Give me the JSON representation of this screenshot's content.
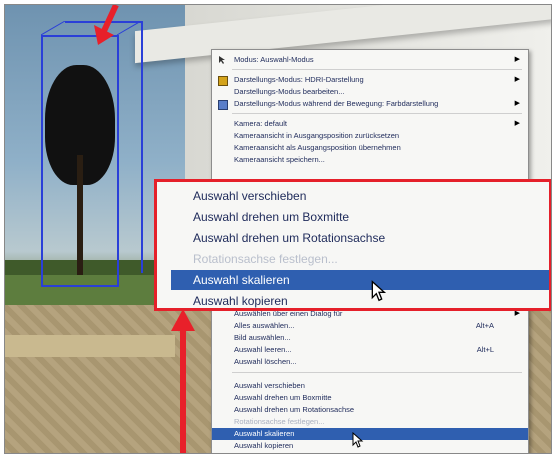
{
  "menu": {
    "items": [
      {
        "label": "Modus: Auswahl-Modus",
        "submenu": true,
        "icon": "cursor-icon"
      },
      {
        "label": "Darstellungs-Modus: HDRI-Darstellung",
        "submenu": true,
        "icon": "render-icon"
      },
      {
        "label": "Darstellungs-Modus bearbeiten...",
        "submenu": false
      },
      {
        "label": "Darstellungs-Modus während der Bewegung: Farbdarstellung",
        "submenu": true,
        "icon": "palette-icon"
      },
      {
        "label": "Kamera: default",
        "submenu": true
      },
      {
        "label": "Kameraansicht in Ausgangsposition zurücksetzen",
        "submenu": false
      },
      {
        "label": "Kameraansicht als Ausgangsposition übernehmen",
        "submenu": false
      },
      {
        "label": "Kameraansicht speichern...",
        "submenu": false
      },
      {
        "label": "Auswählen über einen Dialog für",
        "submenu": true
      },
      {
        "label": "Alles auswählen...",
        "shortcut": "Alt+A"
      },
      {
        "label": "Bild auswählen..."
      },
      {
        "label": "Auswahl leeren...",
        "shortcut": "Alt+L"
      },
      {
        "label": "Auswahl löschen..."
      },
      {
        "label": "Auswahl verschieben"
      },
      {
        "label": "Auswahl drehen um Boxmitte"
      },
      {
        "label": "Auswahl drehen um Rotationsachse"
      },
      {
        "label": "Rotationsachse festlegen...",
        "disabled": true
      },
      {
        "label": "Auswahl skalieren",
        "highlighted": true
      },
      {
        "label": "Auswahl kopieren"
      }
    ]
  },
  "zoom": {
    "items": [
      {
        "label": "Auswahl verschieben"
      },
      {
        "label": "Auswahl drehen um Boxmitte"
      },
      {
        "label": "Auswahl drehen um Rotationsachse"
      },
      {
        "label": "Rotationsachse festlegen...",
        "disabled": true
      },
      {
        "label": "Auswahl skalieren",
        "highlighted": true
      },
      {
        "label": "Auswahl kopieren"
      }
    ],
    "border_color": "#e5202a"
  },
  "colors": {
    "highlight": "#2f5fb0",
    "annotation_red": "#e8202a",
    "bbox_blue": "#2a3fd8"
  }
}
